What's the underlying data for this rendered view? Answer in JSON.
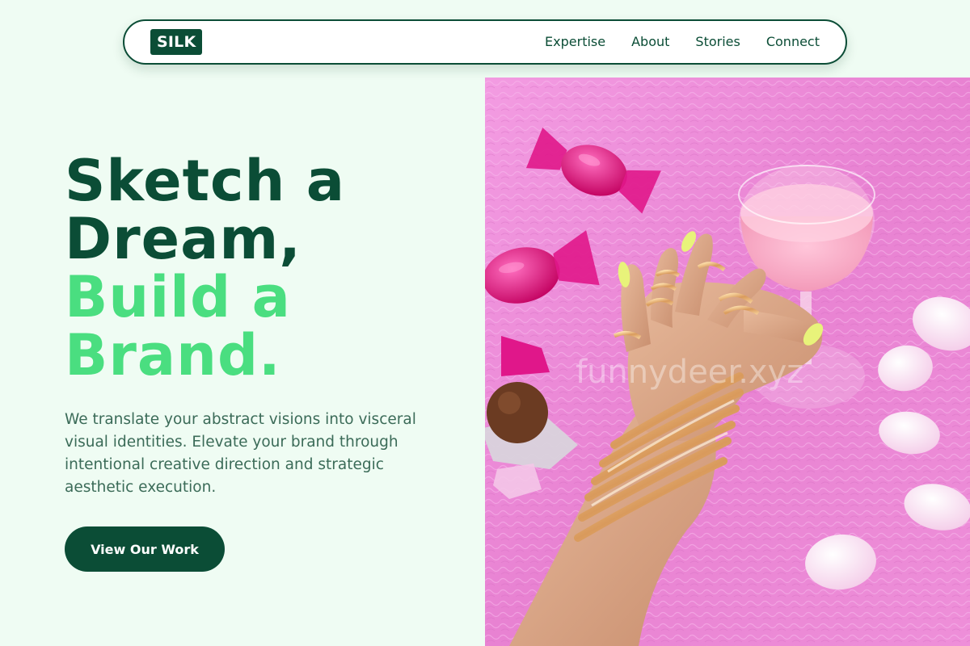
{
  "brand": {
    "logo_text": "SILK",
    "colors": {
      "primary_dark": "#0b4d36",
      "accent_green": "#4ade80",
      "background": "#effcf3",
      "body_text": "#3b6b58"
    }
  },
  "nav": {
    "links": [
      {
        "label": "Expertise"
      },
      {
        "label": "About"
      },
      {
        "label": "Stories"
      },
      {
        "label": "Connect"
      }
    ]
  },
  "hero": {
    "headline_dark_1": "Sketch a",
    "headline_dark_2": "Dream,",
    "headline_light_1": "Build a",
    "headline_light_2": "Brand.",
    "subtext": "We translate your abstract visions into visceral visual identities. Elevate your brand through intentional creative direction and strategic aesthetic execution.",
    "cta_label": "View Our Work"
  },
  "image": {
    "watermark": "funnydeer.xyz",
    "description_icon": "hand-with-gold-jewelry-and-cocktail-photo"
  }
}
